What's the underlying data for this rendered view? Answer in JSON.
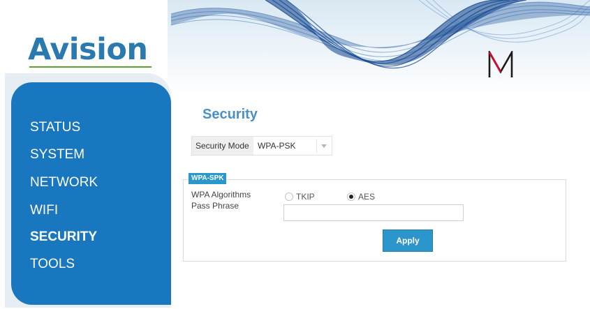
{
  "brand": {
    "logo_text": "Avision",
    "logo_color": "#2a7ab0",
    "accent_color": "#1877bf",
    "mark_text": "M"
  },
  "sidebar": {
    "items": [
      {
        "label": "STATUS",
        "active": false
      },
      {
        "label": "SYSTEM",
        "active": false
      },
      {
        "label": "NETWORK",
        "active": false
      },
      {
        "label": "WIFI",
        "active": false
      },
      {
        "label": "SECURITY",
        "active": true
      },
      {
        "label": "TOOLS",
        "active": false
      }
    ]
  },
  "main": {
    "title": "Security",
    "security_mode": {
      "label": "Security Mode",
      "value": "WPA-PSK"
    },
    "group": {
      "tag": "WPA-SPK",
      "algorithms_label": "WPA Algorithms",
      "options": [
        {
          "label": "TKIP",
          "checked": false
        },
        {
          "label": "AES",
          "checked": true
        }
      ],
      "passphrase_label": "Pass Phrase",
      "passphrase_value": ""
    },
    "apply_label": "Apply"
  }
}
